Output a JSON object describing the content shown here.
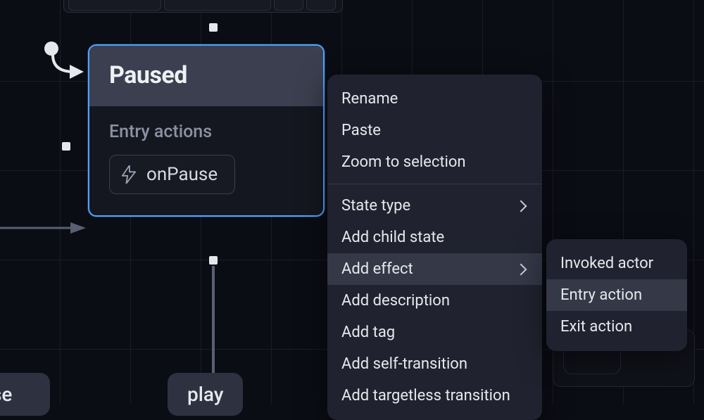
{
  "node": {
    "title": "Paused",
    "section_label": "Entry actions",
    "action_name": "onPause"
  },
  "events": {
    "pause": "se",
    "play": "play"
  },
  "context_menu": {
    "rename": "Rename",
    "paste": "Paste",
    "zoom": "Zoom to selection",
    "state_type": "State type",
    "add_child": "Add child state",
    "add_effect": "Add effect",
    "add_description": "Add description",
    "add_tag": "Add tag",
    "add_self_transition": "Add self-transition",
    "add_targetless": "Add targetless transition"
  },
  "effect_submenu": {
    "invoked_actor": "Invoked actor",
    "entry_action": "Entry action",
    "exit_action": "Exit action"
  }
}
